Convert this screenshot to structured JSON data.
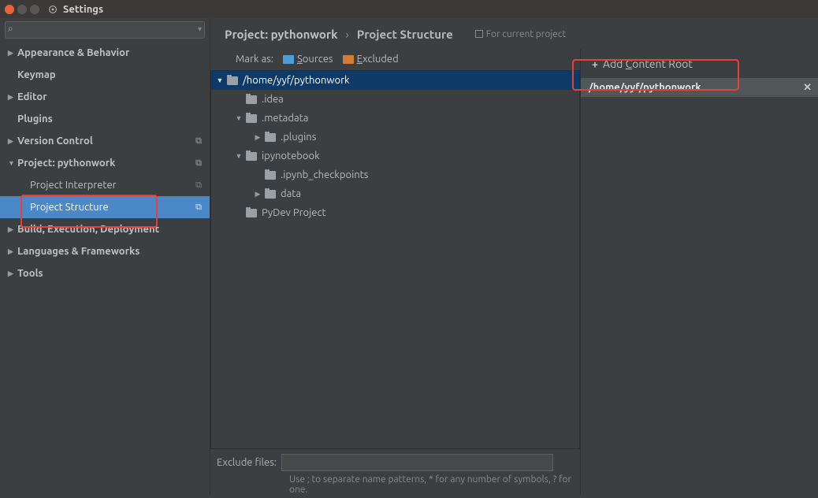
{
  "window": {
    "title": "Settings"
  },
  "search": {
    "placeholder": ""
  },
  "sidebar": {
    "items": [
      {
        "label": "Appearance & Behavior",
        "expandable": true,
        "indent": 0
      },
      {
        "label": "Keymap",
        "expandable": false,
        "indent": 0
      },
      {
        "label": "Editor",
        "expandable": true,
        "indent": 0
      },
      {
        "label": "Plugins",
        "expandable": false,
        "indent": 0
      },
      {
        "label": "Version Control",
        "expandable": true,
        "indent": 0,
        "copy": true
      },
      {
        "label": "Project: pythonwork",
        "expandable": true,
        "indent": 0,
        "expanded": true,
        "copy": true
      },
      {
        "label": "Project Interpreter",
        "expandable": false,
        "indent": 1,
        "copy": true
      },
      {
        "label": "Project Structure",
        "expandable": false,
        "indent": 1,
        "copy": true,
        "selected": true
      },
      {
        "label": "Build, Execution, Deployment",
        "expandable": true,
        "indent": 0
      },
      {
        "label": "Languages & Frameworks",
        "expandable": true,
        "indent": 0
      },
      {
        "label": "Tools",
        "expandable": true,
        "indent": 0
      }
    ]
  },
  "breadcrumb": {
    "project": "Project: pythonwork",
    "page": "Project Structure",
    "note": "For current project"
  },
  "markas": {
    "label": "Mark as:",
    "sources": "Sources",
    "excluded": "Excluded"
  },
  "tree": [
    {
      "depth": 0,
      "label": "/home/yyf/pythonwork",
      "arrow": "down",
      "selected": true
    },
    {
      "depth": 1,
      "label": ".idea",
      "arrow": ""
    },
    {
      "depth": 1,
      "label": ".metadata",
      "arrow": "down"
    },
    {
      "depth": 2,
      "label": ".plugins",
      "arrow": "right"
    },
    {
      "depth": 1,
      "label": "ipynotebook",
      "arrow": "down"
    },
    {
      "depth": 2,
      "label": ".ipynb_checkpoints",
      "arrow": ""
    },
    {
      "depth": 2,
      "label": "data",
      "arrow": "right"
    },
    {
      "depth": 1,
      "label": "PyDev Project",
      "arrow": ""
    }
  ],
  "exclude": {
    "label": "Exclude files:",
    "value": "",
    "hint": "Use ; to separate name patterns, * for any number of symbols, ? for one."
  },
  "rightRail": {
    "addLabel": "Add Content Root",
    "roots": [
      {
        "path": "/home/yyf/pythonwork"
      }
    ]
  }
}
